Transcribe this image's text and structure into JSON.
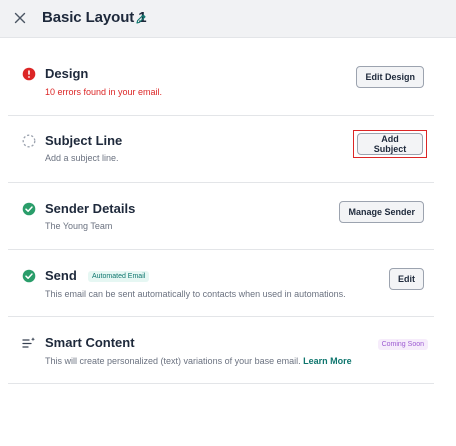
{
  "header": {
    "title": "Basic Layout 1",
    "close_icon": "close-icon",
    "edit_icon": "pencil-icon"
  },
  "colors": {
    "error": "#dc2626",
    "success": "#2a9d6a",
    "accent": "#0f766e",
    "highlight_border": "#dc2626"
  },
  "sections": [
    {
      "id": "design",
      "icon": "error-circle-icon",
      "title": "Design",
      "subtitle": "10 errors found in your email.",
      "button": "Edit Design"
    },
    {
      "id": "subject",
      "icon": "dashed-circle-icon",
      "title": "Subject Line",
      "subtitle": "Add a subject line.",
      "button": "Add Subject"
    },
    {
      "id": "sender",
      "icon": "check-circle-icon",
      "title": "Sender Details",
      "subtitle": "The Young Team",
      "button": "Manage Sender"
    },
    {
      "id": "send",
      "icon": "check-circle-icon",
      "title": "Send",
      "badge": "Automated Email",
      "subtitle": "This email can be sent automatically to contacts when used in automations.",
      "button": "Edit"
    },
    {
      "id": "smart",
      "icon": "sparkle-list-icon",
      "title": "Smart Content",
      "badge": "Coming Soon",
      "subtitle": "This will create personalized (text) variations of your base email.",
      "link": "Learn More"
    }
  ]
}
